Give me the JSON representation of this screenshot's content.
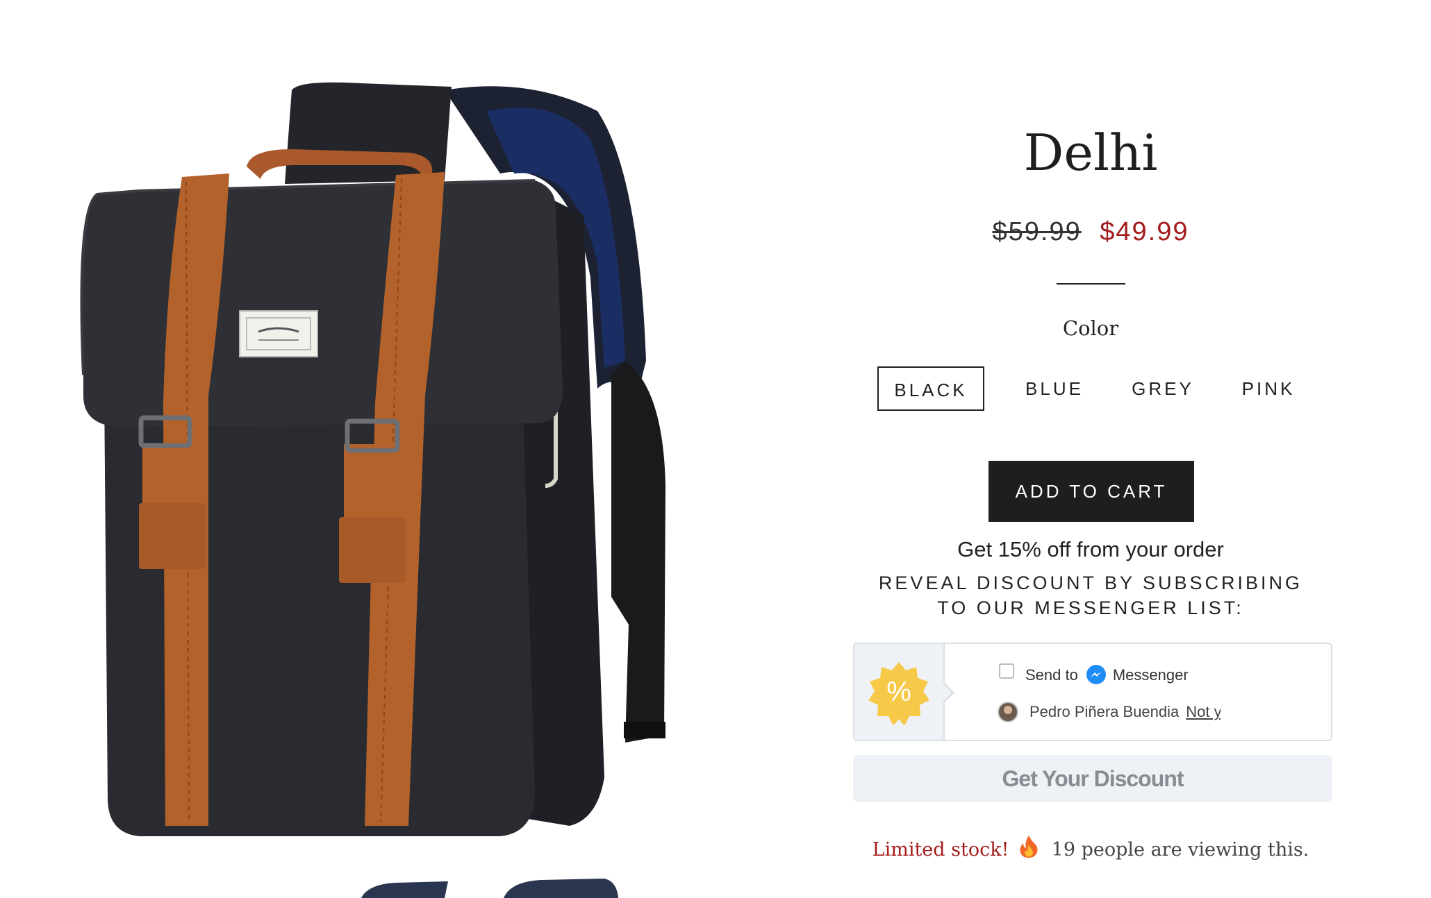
{
  "product": {
    "title": "Delhi",
    "price_original": "$59.99",
    "price_sale": "$49.99"
  },
  "options": {
    "color_label": "Color",
    "colors": [
      "BLACK",
      "BLUE",
      "GREY",
      "PINK"
    ],
    "selected": "BLACK"
  },
  "cart": {
    "add_label": "ADD TO CART"
  },
  "promo": {
    "headline": "Get 15% off from your order",
    "reveal_text": "REVEAL DISCOUNT BY SUBSCRIBING TO OUR MESSENGER LIST:",
    "badge_symbol": "%",
    "send_to_label": "Send to",
    "messenger_label": "Messenger",
    "user_name": "Pedro Piñera Buendia",
    "not_you_label": "Not you?",
    "cta_label": "Get Your Discount"
  },
  "stock": {
    "limited_label": "Limited stock!",
    "viewers_text": "19 people are viewing this."
  },
  "icons": {
    "badge": "percent-badge-icon",
    "messenger": "messenger-icon",
    "fire": "fire-icon"
  },
  "colors": {
    "sale_red": "#a31c1c",
    "button_dark": "#1e1e1e",
    "badge_yellow": "#f7c948",
    "messenger_blue": "#1f8cf5"
  }
}
